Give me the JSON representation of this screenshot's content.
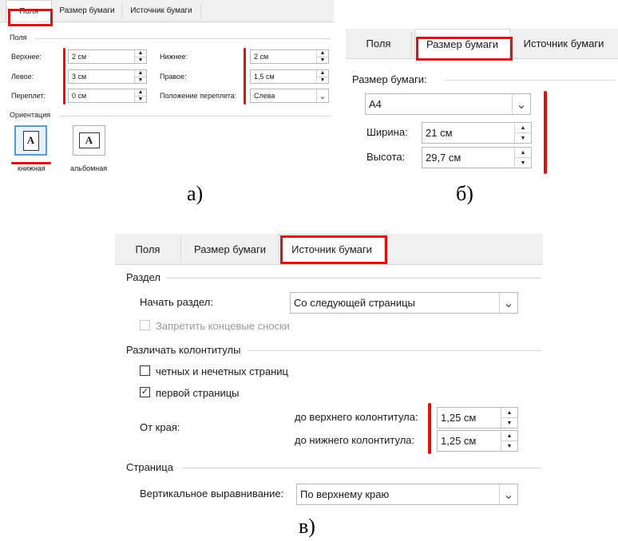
{
  "captions": {
    "a": "а)",
    "b": "б)",
    "c": "в)"
  },
  "dialog_a": {
    "tabs": [
      "Поля",
      "Размер бумаги",
      "Источник бумаги"
    ],
    "group_margins": "Поля",
    "top_label": "Верхнее:",
    "top_value": "2 см",
    "left_label": "Левое:",
    "left_value": "3 см",
    "gutter_label": "Переплет:",
    "gutter_value": "0 см",
    "bottom_label": "Нижнее:",
    "bottom_value": "2 см",
    "right_label": "Правое:",
    "right_value": "1,5 см",
    "gutter_pos_label": "Положение переплета:",
    "gutter_pos_value": "Слева",
    "group_orientation": "Ориентация",
    "portrait_label": "книжная",
    "landscape_label": "альбомная",
    "orientation_glyph": "A"
  },
  "dialog_b": {
    "tabs": [
      "Поля",
      "Размер бумаги",
      "Источник бумаги"
    ],
    "group_paper": "Размер бумаги:",
    "paper_value": "A4",
    "width_label": "Ширина:",
    "width_value": "21 см",
    "height_label": "Высота:",
    "height_value": "29,7 см"
  },
  "dialog_c": {
    "tabs": [
      "Поля",
      "Размер бумаги",
      "Источник бумаги"
    ],
    "group_section": "Раздел",
    "section_start_label": "Начать раздел:",
    "section_start_value": "Со следующей страницы",
    "suppress_endnotes": "Запретить концевые сноски",
    "group_headers": "Различать колонтитулы",
    "odd_even": "четных и нечетных страниц",
    "first_page": "первой страницы",
    "from_edge": "От края:",
    "header_label": "до верхнего колонтитула:",
    "header_value": "1,25 см",
    "footer_label": "до нижнего колонтитула:",
    "footer_value": "1,25 см",
    "group_page": "Страница",
    "valign_label": "Вертикальное выравнивание:",
    "valign_value": "По верхнему краю"
  },
  "icons": {
    "spin_up": "▲",
    "spin_down": "▼",
    "dropdown": "⌄",
    "check": "✓"
  }
}
